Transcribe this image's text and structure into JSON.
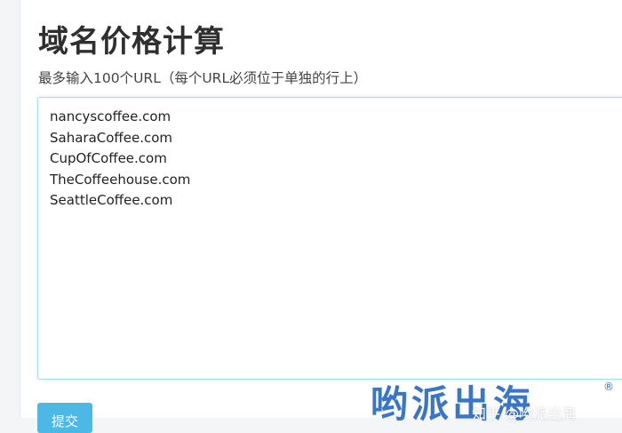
{
  "page": {
    "title": "域名价格计算",
    "hint": "最多输入100个URL（每个URL必须位于单独的行上）"
  },
  "textarea": {
    "value": "nancyscoffee.com\nSaharaCoffee.com\nCupOfCoffee.com\nTheCoffeehouse.com\nSeattleCoffee.com"
  },
  "actions": {
    "submit_label": "提交"
  },
  "watermark": {
    "logo_text": "哟派出海",
    "registered_mark": "®",
    "caption": "知乎 @哟派出海"
  },
  "colors": {
    "accent": "#4cb8e6",
    "textarea_border": "#a9dbf2",
    "watermark": "#2f6fc8"
  }
}
